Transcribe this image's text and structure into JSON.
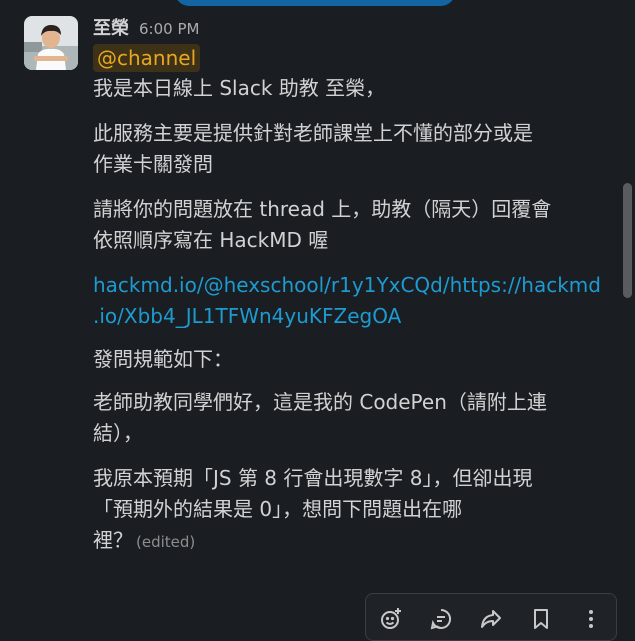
{
  "message": {
    "sender": "至榮",
    "time": "6:00 PM",
    "mention": "@channel",
    "intro": "我是本日線上 Slack 助教 至榮，",
    "purpose_line1": "此服務主要是提供針對老師課堂上不懂的部分或是",
    "purpose_line2": "作業卡關發問",
    "request_line1": "請將你的問題放在 thread 上，助教（隔天）回覆會",
    "request_line2": "依照順序寫在 HackMD 喔",
    "link_line1": "hackmd.io/@hexschool/r1y1YxCQd/https://hackmd",
    "link_line2": ".io/Xbb4_JL1TFWn4yuKFZegOA",
    "rules_title": "發問規範如下：",
    "example1_line1": "老師助教同學們好，這是我的 CodePen（請附上連",
    "example1_line2": "結），",
    "example2_line1": "我原本預期「JS 第 8 行會出現數字 8」，但卻出現",
    "example2_line2": "「預期外的結果是 0」，想問下問題出在哪",
    "example2_line3": "裡？",
    "edited": "(edited)"
  },
  "toolbar": {
    "icons": [
      "add-reaction-icon",
      "reply-thread-icon",
      "share-icon",
      "bookmark-icon",
      "more-actions-icon"
    ]
  },
  "colors": {
    "background": "#1a1d21",
    "text": "#d1d2d3",
    "link": "#1d9bd1",
    "mention_bg": "#3d3217",
    "mention_text": "#e8a723",
    "top_banner": "#1264a3"
  }
}
